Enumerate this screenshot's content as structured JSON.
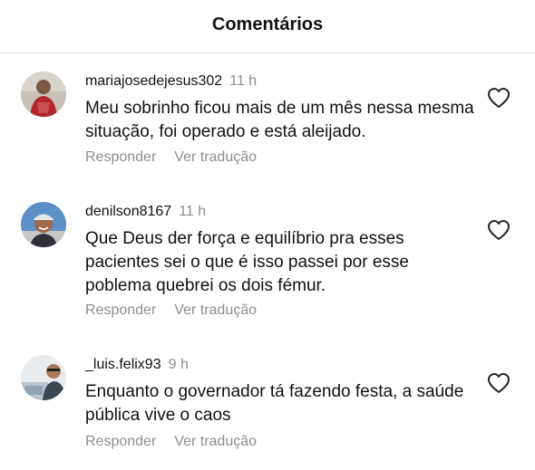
{
  "header": {
    "title": "Comentários"
  },
  "comments": [
    {
      "username": "mariajosedejesus302",
      "time": "11 h",
      "text": "Meu sobrinho ficou mais de um mês nessa mesma situação, foi operado e está aleijado.",
      "reply_label": "Responder",
      "translate_label": "Ver tradução"
    },
    {
      "username": "denilson8167",
      "time": "11 h",
      "text": "Que Deus der força e equilíbrio pra esses pacientes sei o que é isso passei por esse poblema quebrei os dois fémur.",
      "reply_label": "Responder",
      "translate_label": "Ver tradução"
    },
    {
      "username": "_luis.felix93",
      "time": "9 h",
      "text": "Enquanto o governador tá fazendo festa, a saúde pública vive o caos",
      "reply_label": "Responder",
      "translate_label": "Ver tradução"
    }
  ],
  "icons": {
    "like": "heart-outline-icon"
  },
  "colors": {
    "text": "#111111",
    "muted": "#8e8e8e",
    "divider": "#e6e6e6"
  }
}
